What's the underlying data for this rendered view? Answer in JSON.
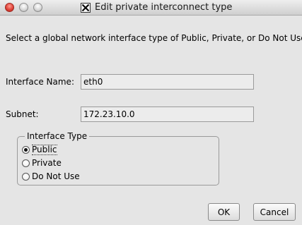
{
  "window": {
    "title": "Edit private interconnect type"
  },
  "prompt": "Select a global network interface type of Public, Private, or Do Not Use.",
  "fields": {
    "interface_name": {
      "label": "Interface Name:",
      "value": "eth0"
    },
    "subnet": {
      "label": "Subnet:",
      "value": "172.23.10.0"
    }
  },
  "interface_type": {
    "title": "Interface Type",
    "options": [
      {
        "label": "Public",
        "selected": true
      },
      {
        "label": "Private",
        "selected": false
      },
      {
        "label": "Do Not Use",
        "selected": false
      }
    ]
  },
  "buttons": {
    "ok": "OK",
    "cancel": "Cancel"
  },
  "icons": {
    "close": "close-icon",
    "minimize": "minimize-icon",
    "maximize": "maximize-icon",
    "app": "x11-icon"
  },
  "colors": {
    "close_button": "#e0443a",
    "background": "#e5e5e5"
  }
}
